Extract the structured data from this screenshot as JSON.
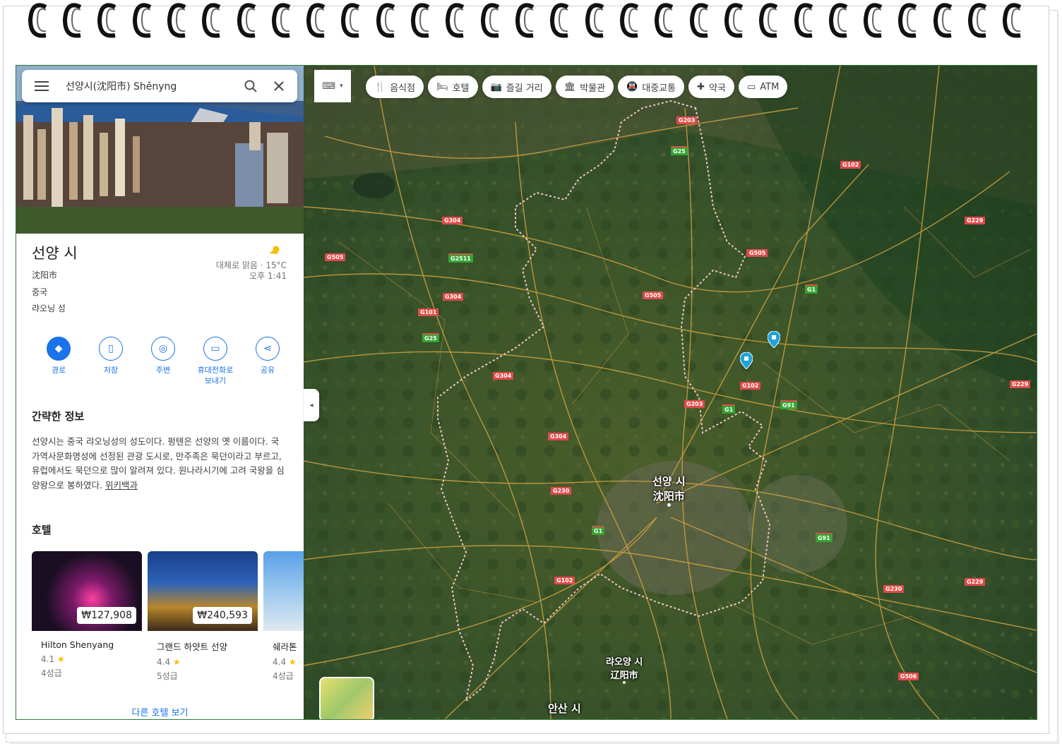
{
  "search": {
    "value": "선양시(沈阳市) Shěnyng"
  },
  "place": {
    "name": "선양 시",
    "native_name": "沈阳市",
    "country": "중국",
    "province": "랴오닝 성",
    "weather": "대체로 맑음 · 15°C",
    "time": "오후 1:41"
  },
  "actions": [
    {
      "label": "경로",
      "icon": "directions-icon"
    },
    {
      "label": "저장",
      "icon": "bookmark-icon"
    },
    {
      "label": "주변",
      "icon": "nearby-icon"
    },
    {
      "label": "휴대전화로 보내기",
      "icon": "phone-icon"
    },
    {
      "label": "공유",
      "icon": "share-icon"
    }
  ],
  "summary": {
    "heading": "간략한 정보",
    "text": "선양시는 중국 랴오닝성의 성도이다. 펑톈은 선양의 옛 이름이다. 국가역사문화명성에 선정된 관광 도시로, 만주족은 묵던이라고 부르고, 유럽에서도 묵던으로 많이 알려져 있다. 원나라시기에 고려 국왕을 심양왕으로 봉하였다.",
    "link": "위키백과"
  },
  "hotels": {
    "heading": "호텔",
    "items": [
      {
        "name": "Hilton Shenyang",
        "price": "₩127,908",
        "rating": "4.1",
        "grade": "4성급"
      },
      {
        "name": "그랜드 하얏트 선양",
        "price": "₩240,593",
        "rating": "4.4",
        "grade": "5성급"
      },
      {
        "name": "쉐라톤",
        "price": "",
        "rating": "4.4",
        "grade": "4성급"
      }
    ],
    "more": "다른 호텔 보기"
  },
  "chips": [
    {
      "label": "음식점",
      "icon": "restaurant-icon"
    },
    {
      "label": "호텔",
      "icon": "hotel-icon"
    },
    {
      "label": "즐길 거리",
      "icon": "camera-icon"
    },
    {
      "label": "박물관",
      "icon": "museum-icon"
    },
    {
      "label": "대중교통",
      "icon": "transit-icon"
    },
    {
      "label": "약국",
      "icon": "pharmacy-icon"
    },
    {
      "label": "ATM",
      "icon": "atm-icon"
    }
  ],
  "map_labels": {
    "city_ko": "선양 시",
    "city_cn": "沈阳市",
    "liaoyang_ko": "랴오양 시",
    "liaoyang_cn": "辽阳市",
    "anshan_ko": "안산 시"
  },
  "road_badges": [
    "G203",
    "G25",
    "G102",
    "G304",
    "G2511",
    "G505",
    "G505",
    "G505",
    "G229",
    "G1",
    "G304",
    "G505",
    "G101",
    "G25",
    "G304",
    "G102",
    "G203",
    "G1",
    "G91",
    "G229",
    "G304",
    "G230",
    "G1",
    "G91",
    "G102",
    "G230",
    "G229",
    "G506"
  ]
}
